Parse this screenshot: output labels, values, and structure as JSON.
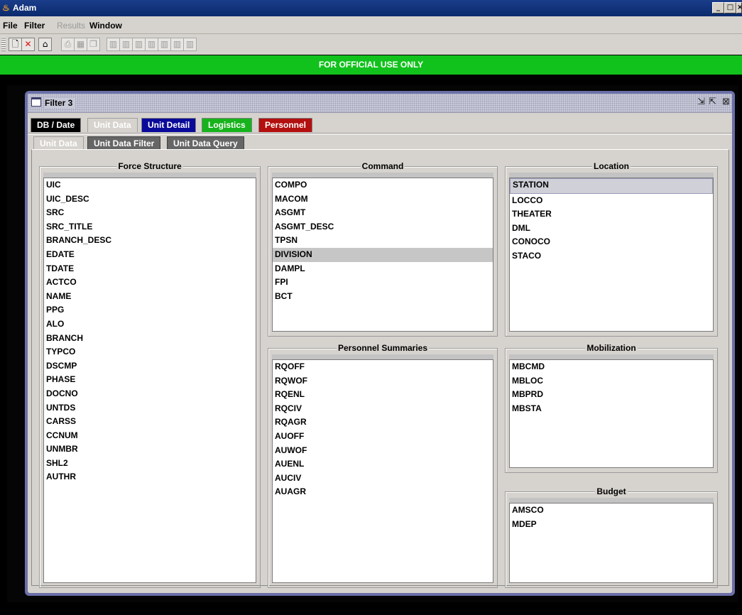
{
  "app": {
    "title": "Adam"
  },
  "menu": {
    "file": "File",
    "filter": "Filter",
    "results": "Results",
    "window": "Window"
  },
  "toolbar": {
    "buttons": [
      "new-icon",
      "delete-icon",
      "sweep-icon",
      "print-icon",
      "grid-icon",
      "copy-icon",
      "column-icon-1",
      "column-icon-2",
      "column-icon-3",
      "column-icon-4"
    ]
  },
  "banner": {
    "text": "FOR OFFICIAL USE ONLY",
    "color": "#11c21c"
  },
  "frame": {
    "title": "Filter 3"
  },
  "top_tabs": [
    {
      "label": "DB / Date",
      "color": "#000000"
    },
    {
      "label": "Unit Data",
      "color": "#d6d3ce",
      "selected": true
    },
    {
      "label": "Unit Detail",
      "color": "#0a0a9a"
    },
    {
      "label": "Logistics",
      "color": "#17b31c"
    },
    {
      "label": "Personnel",
      "color": "#b30f0f"
    }
  ],
  "sub_tabs": [
    {
      "label": "Unit Data",
      "selected": true
    },
    {
      "label": "Unit Data Filter"
    },
    {
      "label": "Unit Data Query"
    }
  ],
  "groups": {
    "force_structure": {
      "title": "Force Structure",
      "items": [
        "UIC",
        "UIC_DESC",
        "SRC",
        "SRC_TITLE",
        "BRANCH_DESC",
        "EDATE",
        "TDATE",
        "ACTCO",
        "NAME",
        "PPG",
        "ALO",
        "BRANCH",
        "TYPCO",
        "DSCMP",
        "PHASE",
        "DOCNO",
        "UNTDS",
        "CARSS",
        "CCNUM",
        "UNMBR",
        "SHL2",
        "AUTHR"
      ]
    },
    "command": {
      "title": "Command",
      "items": [
        "COMPO",
        "MACOM",
        "ASGMT",
        "ASGMT_DESC",
        "TPSN",
        "DIVISION",
        "DAMPL",
        "FPI",
        "BCT"
      ],
      "selected": "DIVISION"
    },
    "location": {
      "title": "Location",
      "items": [
        "STATION",
        "LOCCO",
        "THEATER",
        "DML",
        "CONOCO",
        "STACO"
      ],
      "selected": "STATION"
    },
    "personnel_summaries": {
      "title": "Personnel Summaries",
      "items": [
        "RQOFF",
        "RQWOF",
        "RQENL",
        "RQCIV",
        "RQAGR",
        "AUOFF",
        "AUWOF",
        "AUENL",
        "AUCIV",
        "AUAGR"
      ]
    },
    "mobilization": {
      "title": "Mobilization",
      "items": [
        "MBCMD",
        "MBLOC",
        "MBPRD",
        "MBSTA"
      ]
    },
    "budget": {
      "title": "Budget",
      "items": [
        "AMSCO",
        "MDEP"
      ]
    }
  }
}
